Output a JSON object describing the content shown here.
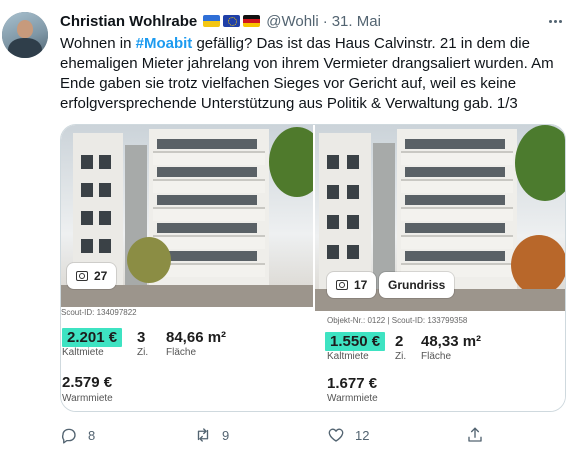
{
  "tweet": {
    "author": "Christian Wohlrabe",
    "handle": "@Wohli",
    "separator": "·",
    "time": "31. Mai",
    "flags": [
      "flag-ukraine-icon",
      "flag-eu-icon",
      "flag-germany-icon"
    ],
    "text_before": "Wohnen in ",
    "hashtag": "#Moabit",
    "text_after": " gefällig? Das ist das Haus Calvinstr. 21 in dem die ehemaligen Mieter jahrelang von ihrem Vermieter drangsaliert wurden. Am Ende gaben sie trotz vielfachen Sieges vor Gericht auf, weil es keine erfolgversprechende Unterstützung aus Politik & Verwaltung gab. 1/3"
  },
  "media": {
    "left": {
      "photo_count": "27",
      "id_line": "Scout-ID: 134097822",
      "price": "2.201 €",
      "price_label": "Kaltmiete",
      "rooms": "3",
      "rooms_label": "Zi.",
      "area": "84,66 m²",
      "area_label": "Fläche",
      "warm": "2.579 €",
      "warm_label": "Warmmiete"
    },
    "right": {
      "photo_count": "17",
      "floorplan_label": "Grundriss",
      "id_line": "Objekt-Nr.: 0122 | Scout-ID: 133799358",
      "price": "1.550 €",
      "price_label": "Kaltmiete",
      "rooms": "2",
      "rooms_label": "Zi.",
      "area": "48,33 m²",
      "area_label": "Fläche",
      "warm": "1.677 €",
      "warm_label": "Warmmiete"
    }
  },
  "actions": {
    "replies": "8",
    "retweets": "9",
    "likes": "12"
  },
  "colors": {
    "accent": "#1d9bf0",
    "price_highlight": "#3ee3c2",
    "muted": "#536471"
  }
}
